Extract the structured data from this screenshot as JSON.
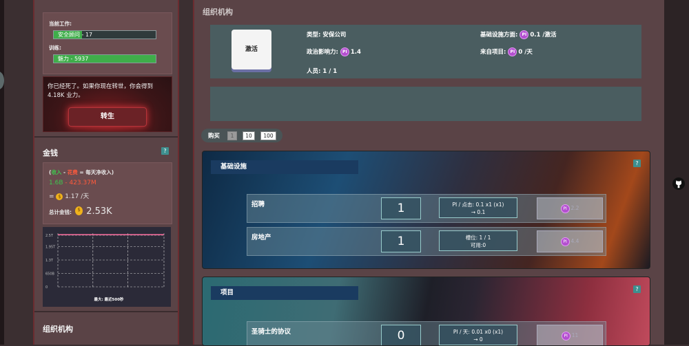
{
  "sidebar": {
    "job": {
      "current_label": "当前工作:",
      "current_value": "安全顾问 - 17",
      "current_progress": 0.28,
      "training_label": "训练:",
      "training_value": "魅力 - 5937",
      "training_progress": 1.0
    },
    "dead": {
      "message": "你已经死了。如果你现在转世，你会得到 4.18K 业力。",
      "rebirth_label": "转生"
    },
    "money": {
      "title": "金钱",
      "help": "?",
      "legend_open": "(",
      "legend_income": "收入",
      "legend_minus": " - ",
      "legend_expense": "花费",
      "legend_rest": " = 每天净收入)",
      "income": "1.6B",
      "minus": " - ",
      "expense": "423.37M",
      "equals": "=",
      "net_per_day": "1.17",
      "per_day_unit": " /天",
      "total_label": "总计金钱:",
      "total_value": "2.53K",
      "colors": {
        "income": "#3fc64e",
        "expense": "#ff5a3c"
      }
    },
    "chart": {
      "y_ticks": [
        "2.5T",
        "1.95T",
        "1.3T",
        "650B",
        "0"
      ],
      "footer": "最大: 最近500秒"
    },
    "org_title": "组织机构"
  },
  "chart_data": {
    "type": "line",
    "title": "",
    "xlabel": "最大: 最近500秒",
    "ylabel": "",
    "y_ticks": [
      "0",
      "650B",
      "1.3T",
      "1.95T",
      "2.5T"
    ],
    "ylim": [
      0,
      2.6
    ],
    "series": [
      {
        "values": [
          2.53,
          2.53,
          2.53,
          2.53,
          2.53
        ]
      }
    ],
    "grid": true
  },
  "main": {
    "title": "组织机构",
    "activate_label": "激活",
    "info": {
      "type": "类型: 安保公司",
      "political": "政治影响力:",
      "political_value": "1.4",
      "staff": "人员: 1 / 1",
      "infra": "基础设施方面:",
      "infra_value": "0.1 /激活",
      "projects": "来自项目:",
      "projects_value": "0 /天"
    },
    "buy": {
      "label": "购买",
      "options": [
        "1",
        "10",
        "100"
      ]
    },
    "infrastructure": {
      "title": "基础设施",
      "help": "?",
      "rows": [
        {
          "name": "招聘",
          "qty": "1",
          "stat1": "PI / 点击: 0.1 x1 (x1)",
          "stat2": "→ 0.1",
          "cost": "2.2"
        },
        {
          "name": "房地产",
          "qty": "1",
          "stat1": "槽位: 1 / 1",
          "stat2": "可用:0",
          "cost": "4.4"
        }
      ]
    },
    "projects": {
      "title": "项目",
      "help": "?",
      "rows": [
        {
          "name": "圣骑士的协议",
          "qty": "0",
          "stat1": "PI / 天: 0.01 x0 (x1)",
          "stat2": "→ 0",
          "cost": "11"
        }
      ]
    }
  }
}
